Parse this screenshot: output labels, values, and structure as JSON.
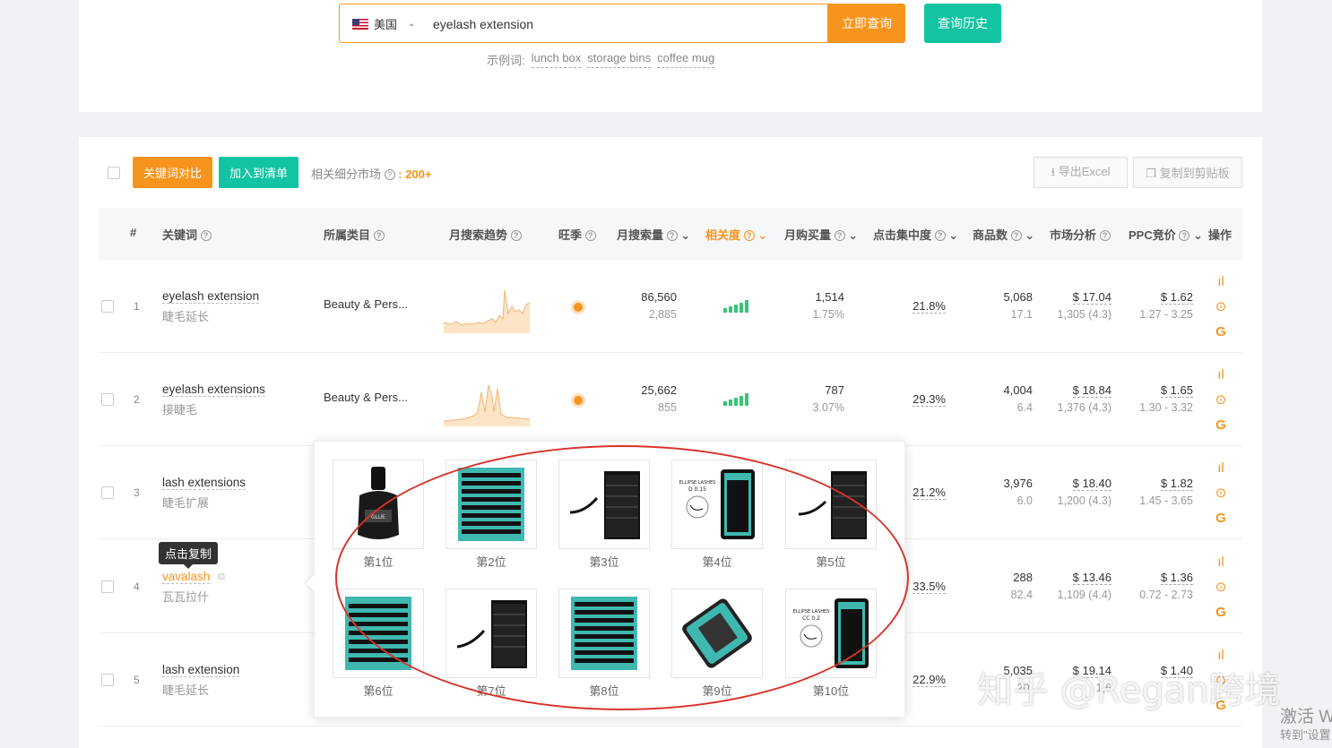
{
  "search": {
    "country": "美国",
    "value": "eyelash extension",
    "query_label": "立即查询",
    "history_label": "查询历史",
    "examples_label": "示例词:",
    "examples": [
      "lunch box",
      "storage bins",
      "coffee mug"
    ]
  },
  "toolbar": {
    "compare_label": "关键词对比",
    "add_label": "加入到清单",
    "market_label": "相关细分市场",
    "market_count": ": 200+",
    "export_label": "导出Excel",
    "copy_label": "复制到剪贴板"
  },
  "columns": {
    "num": "#",
    "keyword": "关键词",
    "category": "所属类目",
    "trend": "月搜索趋势",
    "season": "旺季",
    "search_volume": "月搜索量",
    "relevance": "相关度",
    "purchases": "月购买量",
    "click_concentration": "点击集中度",
    "products": "商品数",
    "market": "市场分析",
    "ppc": "PPC竞价",
    "actions": "操作"
  },
  "rows": [
    {
      "num": "1",
      "keyword": "eyelash extension",
      "keyword_cn": "睫毛延长",
      "category": "Beauty & Pers...",
      "search": "86,560",
      "search_sub": "2,885",
      "purchases": "1,514",
      "purchases_sub": "1.75%",
      "click": "21.8%",
      "products": "5,068",
      "products_sub": "17.1",
      "market": "$ 17.04",
      "market_sub": "1,305 (4.3)",
      "ppc": "$ 1.62",
      "ppc_sub": "1.27 - 3.25"
    },
    {
      "num": "2",
      "keyword": "eyelash extensions",
      "keyword_cn": "接睫毛",
      "category": "Beauty & Pers...",
      "search": "25,662",
      "search_sub": "855",
      "purchases": "787",
      "purchases_sub": "3.07%",
      "click": "29.3%",
      "products": "4,004",
      "products_sub": "6.4",
      "market": "$ 18.84",
      "market_sub": "1,376 (4.3)",
      "ppc": "$ 1.65",
      "ppc_sub": "1.30 - 3.32"
    },
    {
      "num": "3",
      "keyword": "lash extensions",
      "keyword_cn": "睫毛扩展",
      "click": "21.2%",
      "products": "3,976",
      "products_sub": "6.0",
      "market": "$ 18.40",
      "market_sub": "1,200 (4.3)",
      "ppc": "$ 1.82",
      "ppc_sub": "1.45 - 3.65"
    },
    {
      "num": "4",
      "keyword": "vavalash",
      "keyword_cn": "瓦瓦拉什",
      "click": "33.5%",
      "products": "288",
      "products_sub": "82.4",
      "market": "$ 13.46",
      "market_sub": "1,109 (4.4)",
      "ppc": "$ 1.36",
      "ppc_sub": "0.72 - 2.73"
    },
    {
      "num": "5",
      "keyword": "lash extension",
      "keyword_cn": "睫毛延长",
      "click": "22.9%",
      "products": "5,035",
      "products_sub": "20.",
      "market": "$ 19.14",
      "market_sub": "1,6",
      "ppc": "$ 1.40",
      "ppc_sub": ""
    }
  ],
  "tooltip": "点击复制",
  "popover": {
    "ranks": [
      "第1位",
      "第2位",
      "第3位",
      "第4位",
      "第5位",
      "第6位",
      "第7位",
      "第8位",
      "第9位",
      "第10位"
    ]
  },
  "watermark": "知乎 @Regan跨境",
  "os_notice": "激活 W",
  "os_notice2": "转到\"设置",
  "colors": {
    "orange": "#f7941d",
    "teal": "#13c4a3",
    "circle_red": "#d9342b",
    "relevance_green": "#3cc27a"
  }
}
